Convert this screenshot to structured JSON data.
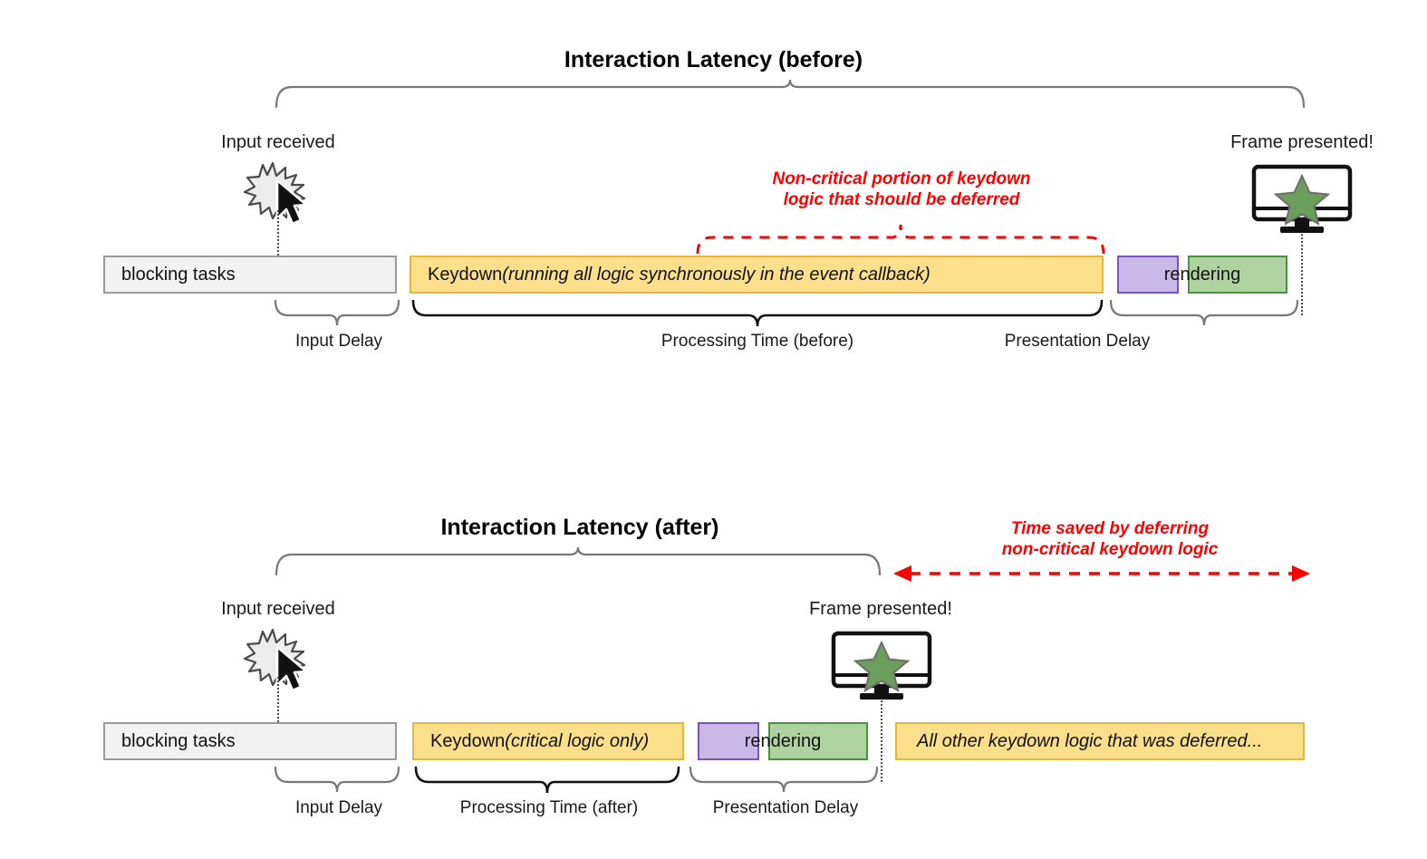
{
  "diagram": {
    "title_before": "Interaction Latency (before)",
    "title_after": "Interaction Latency (after)"
  },
  "before": {
    "input_label": "Input received",
    "frame_label": "Frame presented!",
    "red_note_line1": "Non-critical portion of keydown",
    "red_note_line2": "logic that should be deferred",
    "boxes": {
      "blocking": "blocking tasks",
      "keydown_main": "Keydown ",
      "keydown_italic": "(running all logic synchronously in the event callback)",
      "rendering": "rendering"
    },
    "braces": {
      "input_delay": "Input Delay",
      "processing_time": "Processing Time (before)",
      "presentation_delay": "Presentation Delay"
    }
  },
  "after": {
    "input_label": "Input received",
    "frame_label": "Frame presented!",
    "red_note_line1": "Time saved by deferring",
    "red_note_line2": "non-critical keydown logic",
    "boxes": {
      "blocking": "blocking tasks",
      "keydown_main": "Keydown ",
      "keydown_italic": "(critical logic only)",
      "rendering": "rendering",
      "deferred": "All other keydown logic that was deferred..."
    },
    "braces": {
      "input_delay": "Input Delay",
      "processing_time": "Processing Time (after)",
      "presentation_delay": "Presentation Delay"
    }
  },
  "colors": {
    "keydown_fill": "#fcdf8a",
    "keydown_stroke": "#e8b53a",
    "blocking_fill": "#f2f2f2",
    "blocking_stroke": "#9a9a9a",
    "purple_fill": "#c9b8e8",
    "purple_stroke": "#7b52c0",
    "green_fill": "#aed3a0",
    "green_stroke": "#4a9240",
    "annotation_red": "#ff0000",
    "brace_black": "#111111",
    "brace_gray": "#777777",
    "star_green": "#6a9e5a"
  },
  "icons": {
    "cursor": "mouse-cursor-icon",
    "burst": "input-burst-icon",
    "monitor": "monitor-icon",
    "star": "star-icon"
  }
}
